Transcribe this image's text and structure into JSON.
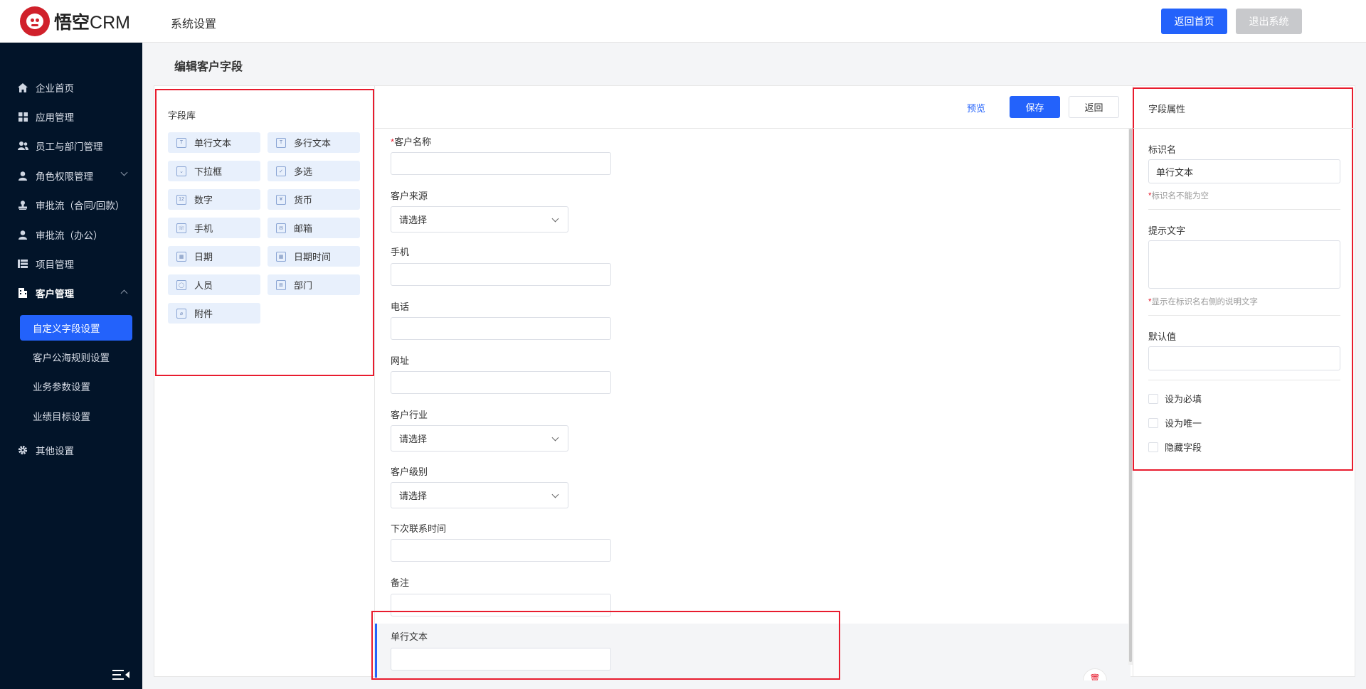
{
  "header": {
    "logo_text": "悟空",
    "logo_crm": "CRM",
    "section_title": "系统设置",
    "home_button": "返回首页",
    "logout_button": "退出系统"
  },
  "sidebar": {
    "items": [
      {
        "label": "企业首页",
        "icon": "home-icon"
      },
      {
        "label": "应用管理",
        "icon": "grid-icon"
      },
      {
        "label": "员工与部门管理",
        "icon": "users-icon"
      },
      {
        "label": "角色权限管理",
        "icon": "user-icon"
      },
      {
        "label": "审批流（合同/回款）",
        "icon": "approval-icon"
      },
      {
        "label": "审批流（办公）",
        "icon": "user-icon"
      },
      {
        "label": "项目管理",
        "icon": "list-icon"
      },
      {
        "label": "客户管理",
        "icon": "building-icon"
      },
      {
        "label": "其他设置",
        "icon": "gear-icon"
      }
    ],
    "sub_items": [
      "自定义字段设置",
      "客户公海规则设置",
      "业务参数设置",
      "业绩目标设置"
    ]
  },
  "page_title": "编辑客户字段",
  "library": {
    "title": "字段库",
    "fields": [
      "单行文本",
      "多行文本",
      "下拉框",
      "多选",
      "数字",
      "货币",
      "手机",
      "邮箱",
      "日期",
      "日期时间",
      "人员",
      "部门",
      "附件"
    ]
  },
  "toolbar": {
    "preview": "预览",
    "save": "保存",
    "back": "返回"
  },
  "form": {
    "required_mark": "*",
    "fields": [
      {
        "label": "客户名称",
        "type": "input"
      },
      {
        "label": "客户来源",
        "type": "select",
        "value": "请选择"
      },
      {
        "label": "手机",
        "type": "input"
      },
      {
        "label": "电话",
        "type": "input"
      },
      {
        "label": "网址",
        "type": "input"
      },
      {
        "label": "客户行业",
        "type": "select",
        "value": "请选择"
      },
      {
        "label": "客户级别",
        "type": "select",
        "value": "请选择"
      },
      {
        "label": "下次联系时间",
        "type": "input"
      },
      {
        "label": "备注",
        "type": "input"
      },
      {
        "label": "单行文本",
        "type": "input"
      }
    ]
  },
  "properties": {
    "title": "字段属性",
    "name_label": "标识名",
    "name_value": "单行文本",
    "name_hint": "标识名不能为空",
    "tip_label": "提示文字",
    "tip_hint": "显示在标识名右侧的说明文字",
    "default_label": "默认值",
    "checkboxes": [
      "设为必填",
      "设为唯一",
      "隐藏字段"
    ]
  },
  "colors": {
    "accent": "#2362fb",
    "sidebar_bg": "#021429",
    "highlight_border": "#e81c2e"
  }
}
